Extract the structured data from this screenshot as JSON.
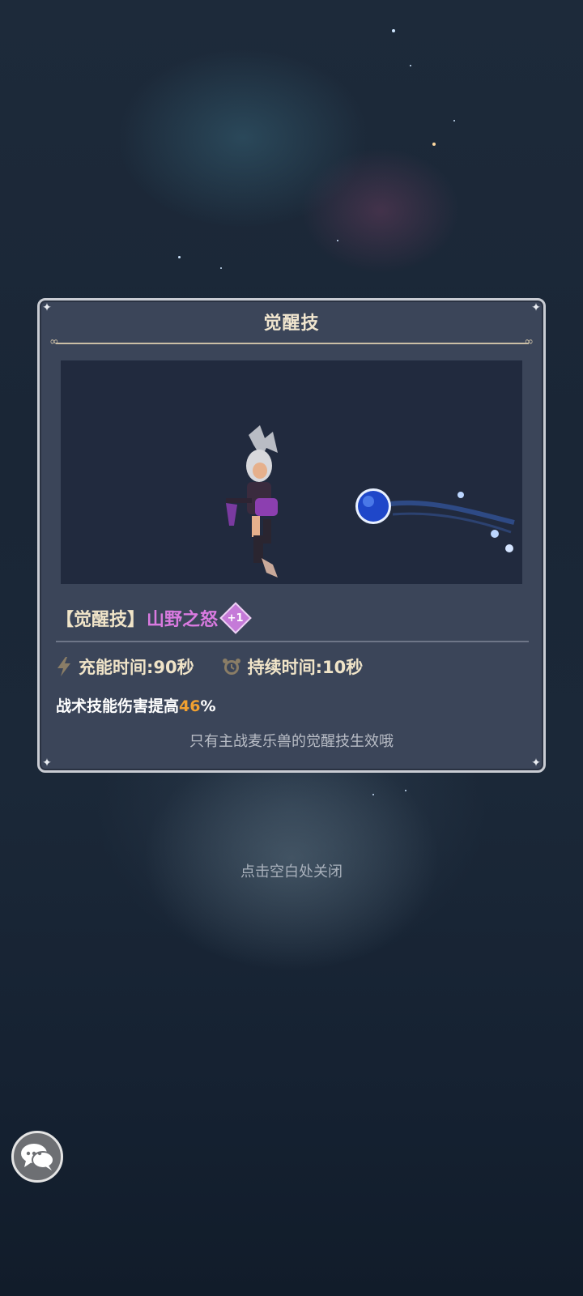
{
  "dialog": {
    "title": "觉醒技",
    "skill_bracket": "【觉醒技】",
    "skill_name": "山野之怒",
    "skill_level_badge": "+1",
    "charge_label": "充能时间:90秒",
    "duration_label": "持续时间:10秒",
    "description_prefix": "战术技能伤害提高",
    "description_value": "46",
    "description_suffix": "%",
    "note": "只有主战麦乐兽的觉醒技生效哦"
  },
  "close_hint": "点击空白处关闭",
  "icons": {
    "charge": "lightning-icon",
    "duration": "alarm-clock-icon",
    "chat": "chat-bubbles-icon"
  },
  "colors": {
    "panel_bg": "#3b4559",
    "skill_name": "#d97ae0",
    "highlight": "#f0a030",
    "label": "#f0e4c8"
  }
}
